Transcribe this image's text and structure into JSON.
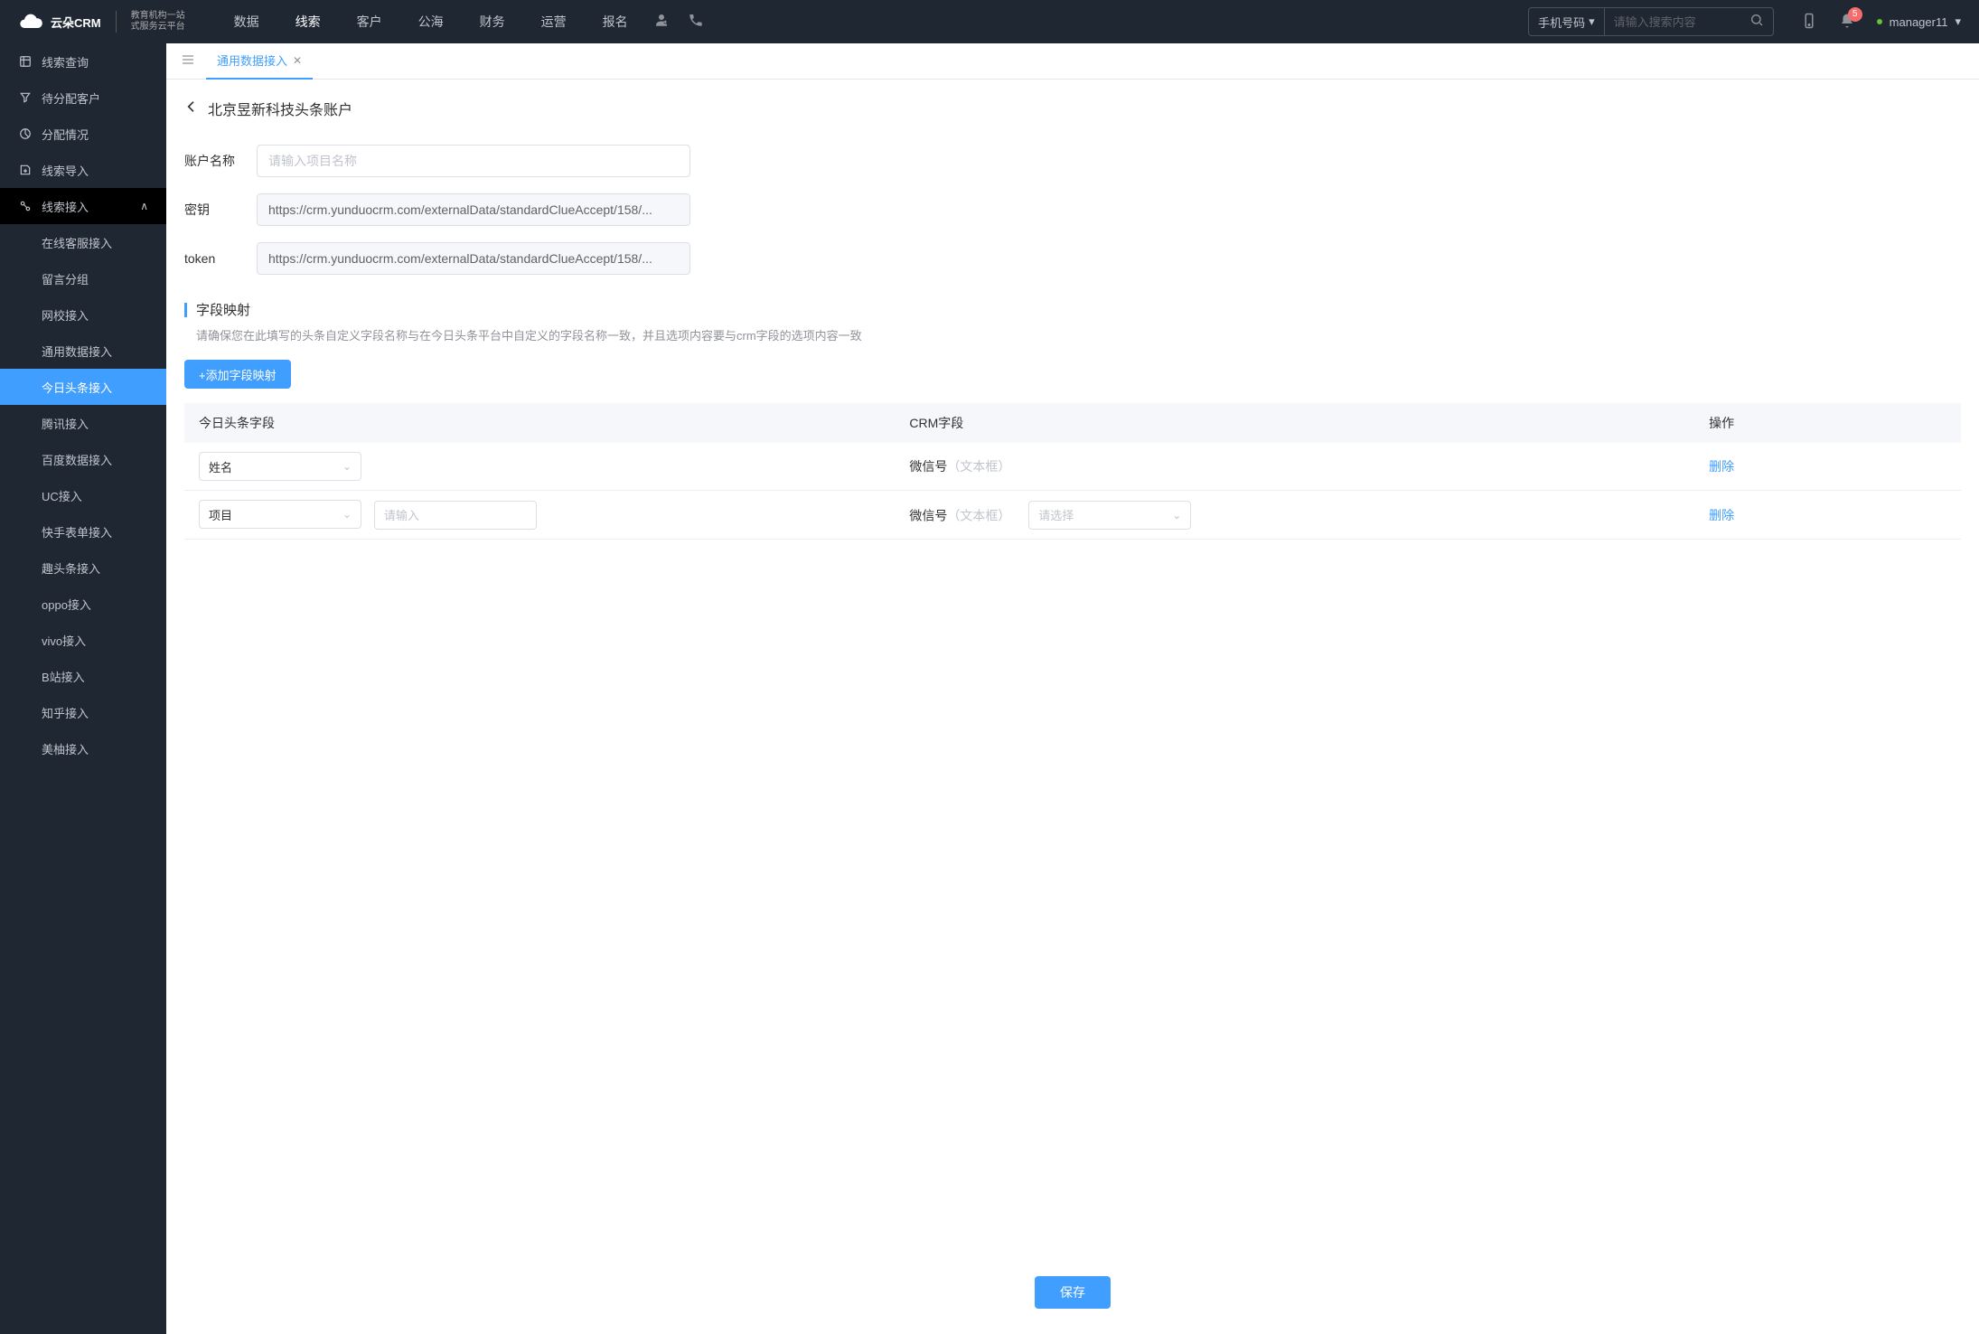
{
  "header": {
    "logo_main": "云朵CRM",
    "logo_sub_line1": "教育机构一站",
    "logo_sub_line2": "式服务云平台",
    "nav": [
      "数据",
      "线索",
      "客户",
      "公海",
      "财务",
      "运营",
      "报名"
    ],
    "nav_active_index": 1,
    "search_type": "手机号码",
    "search_placeholder": "请输入搜索内容",
    "notification_count": "5",
    "username": "manager11"
  },
  "sidebar": {
    "items": [
      {
        "label": "线索查询",
        "icon": "list"
      },
      {
        "label": "待分配客户",
        "icon": "filter"
      },
      {
        "label": "分配情况",
        "icon": "pie"
      },
      {
        "label": "线索导入",
        "icon": "import"
      },
      {
        "label": "线索接入",
        "icon": "plug",
        "expanded": true
      }
    ],
    "sub_items": [
      "在线客服接入",
      "留言分组",
      "网校接入",
      "通用数据接入",
      "今日头条接入",
      "腾讯接入",
      "百度数据接入",
      "UC接入",
      "快手表单接入",
      "趣头条接入",
      "oppo接入",
      "vivo接入",
      "B站接入",
      "知乎接入",
      "美柚接入"
    ],
    "sub_active_index": 4
  },
  "tabs": {
    "items": [
      {
        "label": "通用数据接入"
      }
    ],
    "active_index": 0
  },
  "page": {
    "title": "北京昱新科技头条账户",
    "form": {
      "account_label": "账户名称",
      "account_placeholder": "请输入项目名称",
      "account_value": "",
      "secret_label": "密钥",
      "secret_value": "https://crm.yunduocrm.com/externalData/standardClueAccept/158/...",
      "token_label": "token",
      "token_value": "https://crm.yunduocrm.com/externalData/standardClueAccept/158/..."
    },
    "mapping": {
      "title": "字段映射",
      "desc": "请确保您在此填写的头条自定义字段名称与在今日头条平台中自定义的字段名称一致，并且选项内容要与crm字段的选项内容一致",
      "add_btn": "+添加字段映射",
      "columns": {
        "source": "今日头条字段",
        "crm": "CRM字段",
        "ops": "操作"
      },
      "rows": [
        {
          "source_select": "姓名",
          "source_input_placeholder": "",
          "show_input": false,
          "crm_text": "微信号",
          "crm_hint": "（文本框）",
          "crm_select_placeholder": "",
          "show_crm_select": false,
          "op": "删除"
        },
        {
          "source_select": "项目",
          "source_input_placeholder": "请输入",
          "show_input": true,
          "crm_text": "微信号",
          "crm_hint": "（文本框）",
          "crm_select_placeholder": "请选择",
          "show_crm_select": true,
          "op": "删除"
        }
      ]
    },
    "save_btn": "保存"
  }
}
